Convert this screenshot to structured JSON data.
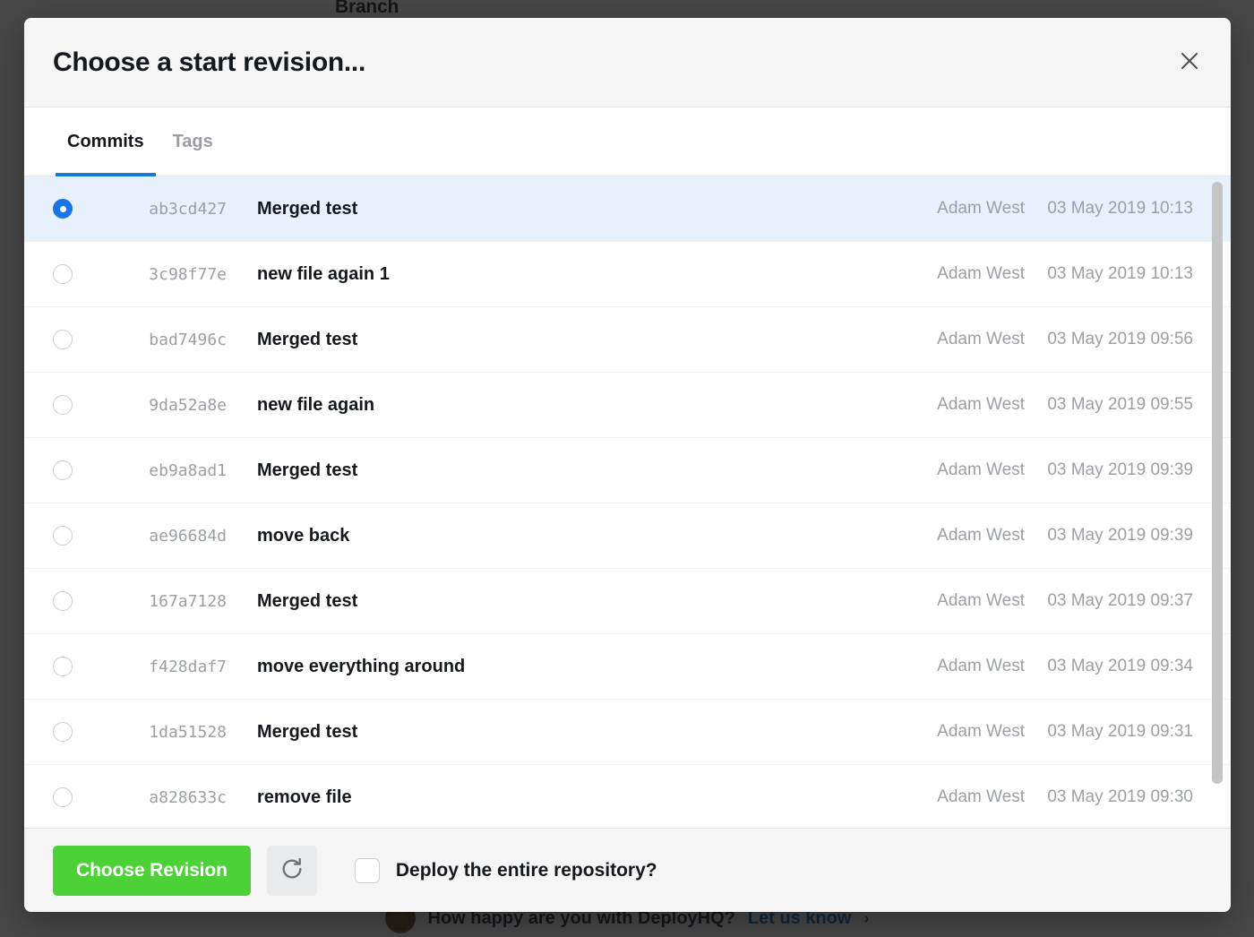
{
  "background": {
    "branch_label": "Branch",
    "feedback_text": "How happy are you with DeployHQ?",
    "feedback_link": "Let us know",
    "feedback_arrow": "›"
  },
  "modal": {
    "title": "Choose a start revision...",
    "close_icon": "close-icon",
    "tabs": [
      {
        "label": "Commits",
        "active": true
      },
      {
        "label": "Tags",
        "active": false
      }
    ],
    "columns": [
      "",
      "hash",
      "message",
      "author",
      "date"
    ],
    "commits": [
      {
        "hash": "ab3cd427",
        "message": "Merged test",
        "author": "Adam West",
        "date": "03 May 2019 10:13",
        "selected": true
      },
      {
        "hash": "3c98f77e",
        "message": "new file again 1",
        "author": "Adam West",
        "date": "03 May 2019 10:13",
        "selected": false
      },
      {
        "hash": "bad7496c",
        "message": "Merged test",
        "author": "Adam West",
        "date": "03 May 2019 09:56",
        "selected": false
      },
      {
        "hash": "9da52a8e",
        "message": "new file again",
        "author": "Adam West",
        "date": "03 May 2019 09:55",
        "selected": false
      },
      {
        "hash": "eb9a8ad1",
        "message": "Merged test",
        "author": "Adam West",
        "date": "03 May 2019 09:39",
        "selected": false
      },
      {
        "hash": "ae96684d",
        "message": "move back",
        "author": "Adam West",
        "date": "03 May 2019 09:39",
        "selected": false
      },
      {
        "hash": "167a7128",
        "message": "Merged test",
        "author": "Adam West",
        "date": "03 May 2019 09:37",
        "selected": false
      },
      {
        "hash": "f428daf7",
        "message": "move everything around",
        "author": "Adam West",
        "date": "03 May 2019 09:34",
        "selected": false
      },
      {
        "hash": "1da51528",
        "message": "Merged test",
        "author": "Adam West",
        "date": "03 May 2019 09:31",
        "selected": false
      },
      {
        "hash": "a828633c",
        "message": "remove file",
        "author": "Adam West",
        "date": "03 May 2019 09:30",
        "selected": false
      }
    ],
    "footer": {
      "choose_revision_label": "Choose Revision",
      "refresh_icon": "refresh-icon",
      "deploy_all_label": "Deploy the entire repository?",
      "deploy_all_checked": false
    }
  },
  "colors": {
    "accent_blue": "#1579d8",
    "radio_blue": "#1a73e8",
    "selected_row": "#e6f1fc",
    "primary_green": "#4cd137",
    "muted_text": "#9b9fa5",
    "overlay": "rgba(20,20,20,0.78)"
  }
}
